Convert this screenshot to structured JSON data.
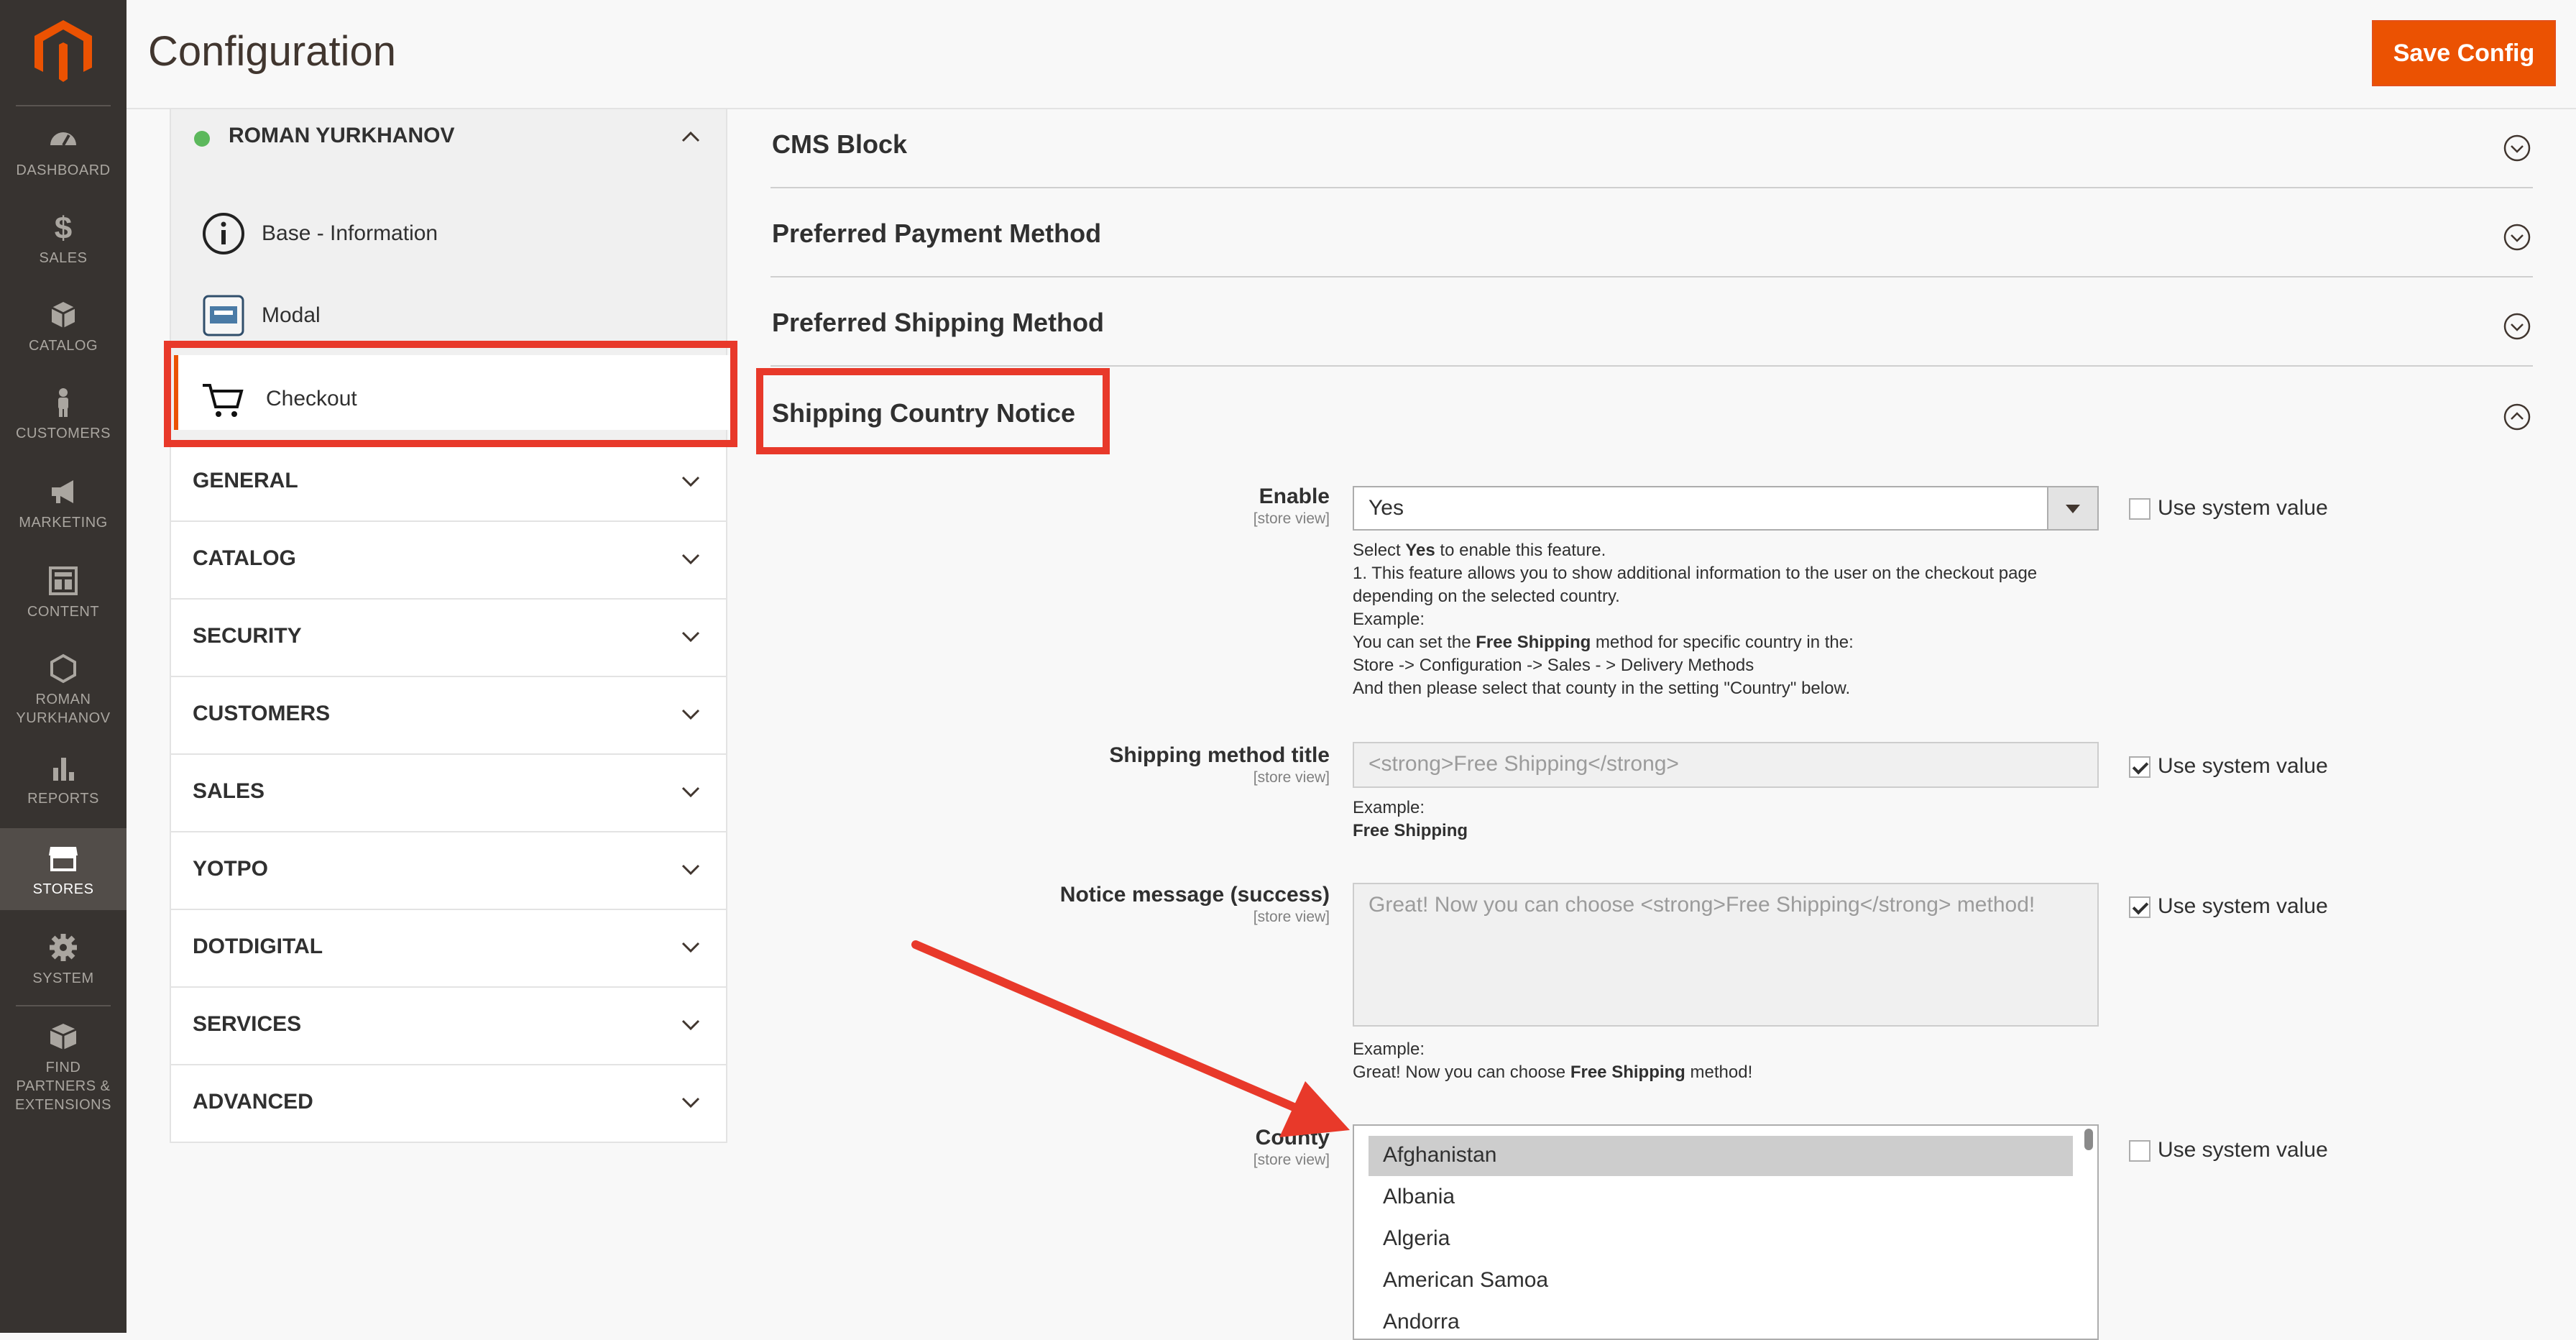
{
  "header": {
    "title": "Configuration",
    "save_label": "Save Config"
  },
  "admin_nav": [
    {
      "label": "DASHBOARD",
      "icon": "dashboard-icon"
    },
    {
      "label": "SALES",
      "icon": "dollar-icon"
    },
    {
      "label": "CATALOG",
      "icon": "box-icon"
    },
    {
      "label": "CUSTOMERS",
      "icon": "person-icon"
    },
    {
      "label": "MARKETING",
      "icon": "megaphone-icon"
    },
    {
      "label": "CONTENT",
      "icon": "layout-icon"
    },
    {
      "label": "ROMAN YURKHANOV",
      "icon": "hexagon-icon"
    },
    {
      "label": "REPORTS",
      "icon": "bar-chart-icon"
    },
    {
      "label": "STORES",
      "icon": "store-icon"
    },
    {
      "label": "SYSTEM",
      "icon": "gear-icon"
    },
    {
      "label": "FIND PARTNERS & EXTENSIONS",
      "icon": "blocks-icon"
    }
  ],
  "config_tabs": {
    "open_group": {
      "title": "ROMAN YURKHANOV",
      "items": [
        {
          "label": "Base - Information",
          "icon": "info-icon"
        },
        {
          "label": "Modal",
          "icon": "window-icon"
        },
        {
          "label": "Checkout",
          "icon": "cart-icon"
        }
      ]
    },
    "groups": [
      "GENERAL",
      "CATALOG",
      "SECURITY",
      "CUSTOMERS",
      "SALES",
      "YOTPO",
      "DOTDIGITAL",
      "SERVICES",
      "ADVANCED"
    ]
  },
  "sections": [
    "CMS Block",
    "Preferred Payment Method",
    "Preferred Shipping Method",
    "Shipping Country Notice"
  ],
  "form": {
    "scope": "[store view]",
    "use_system_value": "Use system value",
    "enable": {
      "label": "Enable",
      "value": "Yes",
      "note": {
        "line1_pre": "Select ",
        "line1_bold": "Yes",
        "line1_post": " to enable this feature.",
        "line2": "1. This feature allows you to show additional information to the user on the checkout page",
        "line3": "depending on the selected country.",
        "line4": "Example:",
        "line5_pre": "You can set the ",
        "line5_bold": "Free Shipping",
        "line5_post": " method for specific country in the:",
        "line6": "Store -> Configuration -> Sales - > Delivery Methods",
        "line7": "And then please select that county in the setting \"Country\" below."
      }
    },
    "shipping_title": {
      "label": "Shipping method title",
      "value": "<strong>Free Shipping</strong>",
      "note_example": "Example:",
      "note_bold": "Free Shipping"
    },
    "notice": {
      "label": "Notice message (success)",
      "value": "Great! Now you can choose <strong>Free Shipping</strong> method!",
      "note_example": "Example:",
      "note_pre": "Great! Now you can choose ",
      "note_bold": "Free Shipping",
      "note_post": " method!"
    },
    "county": {
      "label": "County",
      "options": [
        "Afghanistan",
        "Albania",
        "Algeria",
        "American Samoa",
        "Andorra"
      ],
      "selected": "Afghanistan"
    }
  },
  "colors": {
    "accent": "#eb5202",
    "nav_bg": "#373330",
    "highlight": "#e8392a",
    "status_dot": "#5cb85c"
  }
}
